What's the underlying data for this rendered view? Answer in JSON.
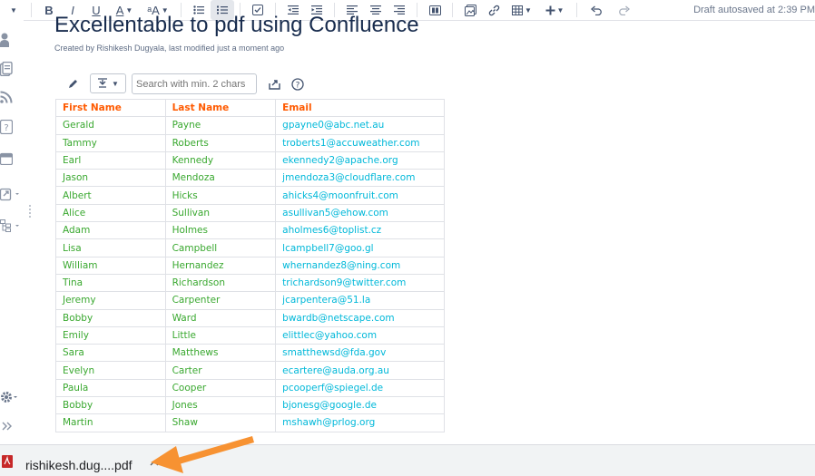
{
  "toolbar": {
    "bold": "B",
    "italic": "I",
    "underline": "U",
    "text_color": "A",
    "text_size": "ᵃA",
    "draft_status": "Draft autosaved at 2:39 PM"
  },
  "page": {
    "title": "Excellentable to pdf using Confluence",
    "byline": "Created by Rishikesh Dugyala, last modified just a moment ago"
  },
  "table_toolbar": {
    "search_placeholder": "Search with min. 2 chars"
  },
  "table": {
    "headers": [
      "First Name",
      "Last Name",
      "Email"
    ],
    "rows": [
      [
        "Gerald",
        "Payne",
        "gpayne0@abc.net.au"
      ],
      [
        "Tammy",
        "Roberts",
        "troberts1@accuweather.com"
      ],
      [
        "Earl",
        "Kennedy",
        "ekennedy2@apache.org"
      ],
      [
        "Jason",
        "Mendoza",
        "jmendoza3@cloudflare.com"
      ],
      [
        "Albert",
        "Hicks",
        "ahicks4@moonfruit.com"
      ],
      [
        "Alice",
        "Sullivan",
        "asullivan5@ehow.com"
      ],
      [
        "Adam",
        "Holmes",
        "aholmes6@toplist.cz"
      ],
      [
        "Lisa",
        "Campbell",
        "lcampbell7@goo.gl"
      ],
      [
        "William",
        "Hernandez",
        "whernandez8@ning.com"
      ],
      [
        "Tina",
        "Richardson",
        "trichardson9@twitter.com"
      ],
      [
        "Jeremy",
        "Carpenter",
        "jcarpentera@51.la"
      ],
      [
        "Bobby",
        "Ward",
        "bwardb@netscape.com"
      ],
      [
        "Emily",
        "Little",
        "elittlec@yahoo.com"
      ],
      [
        "Sara",
        "Matthews",
        "smatthewsd@fda.gov"
      ],
      [
        "Evelyn",
        "Carter",
        "ecartere@auda.org.au"
      ],
      [
        "Paula",
        "Cooper",
        "pcooperf@spiegel.de"
      ],
      [
        "Bobby",
        "Jones",
        "bjonesg@google.de"
      ],
      [
        "Martin",
        "Shaw",
        "mshawh@prlog.org"
      ]
    ]
  },
  "download": {
    "file_name": "rishikesh.dug....pdf"
  },
  "colors": {
    "header_text": "#ff5a00",
    "name_text": "#39a82f",
    "email_text": "#00b8d9",
    "arrow": "#f79232"
  },
  "icons": [
    "person-icon",
    "pages-icon",
    "feed-icon",
    "help-icon",
    "calendar-icon",
    "export-icon",
    "tree-icon",
    "gear-icon",
    "expand-icon",
    "pencil-icon",
    "share-icon",
    "pdf-icon",
    "chevron-up-icon"
  ]
}
